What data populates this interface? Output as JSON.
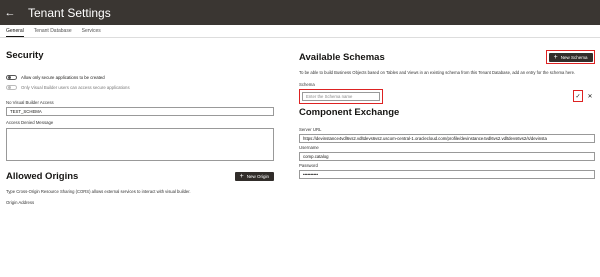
{
  "header": {
    "title": "Tenant Settings",
    "back_icon": "arrow-left-icon"
  },
  "tabs": [
    {
      "label": "General",
      "active": true
    },
    {
      "label": "Tenant Database",
      "active": false
    },
    {
      "label": "Services",
      "active": false
    }
  ],
  "security": {
    "heading": "Security",
    "toggle_secure": "Allow only secure applications to be created",
    "toggle_vb_access": "Only Visual Builder users can access secure applications",
    "no_vb_access_label": "No Visual Builder Access",
    "no_vb_access_value": "TEST_SCHEMA",
    "access_denied_label": "Access Denied Message"
  },
  "origins": {
    "heading": "Allowed Origins",
    "new_origin_label": "New Origin",
    "description": "Type Cross-Origin Resource Sharing (CORS) allows external services to interact with visual builder.",
    "origin_address_label": "Origin Address"
  },
  "schemas": {
    "heading": "Available Schemas",
    "new_schema_label": "New Schema",
    "description": "To be able to build Business Objects based on Tables and Views in an existing schema from this Tenant Database, add an entry for the schema here.",
    "schema_label": "Schema",
    "schema_placeholder": "Enter the Schema name",
    "confirm_icon": "check-icon",
    "cancel_icon": "close-icon"
  },
  "exchange": {
    "heading": "Component Exchange",
    "server_url_label": "Server URL",
    "server_url_value": "https://devinstance4vdl6vs2.vdltdevs6vs2.uscom-central-1.oraclecloud.com/profile/devinstance4vdl6vs2.vdltdevs6vs2/s/devinsta",
    "username_label": "Username",
    "username_value": "comp.catalog",
    "password_label": "Password",
    "password_value": "••••••••••"
  },
  "colors": {
    "header_bg": "#3a3632",
    "button_bg": "#312d2a",
    "highlight": "#dd2222"
  }
}
